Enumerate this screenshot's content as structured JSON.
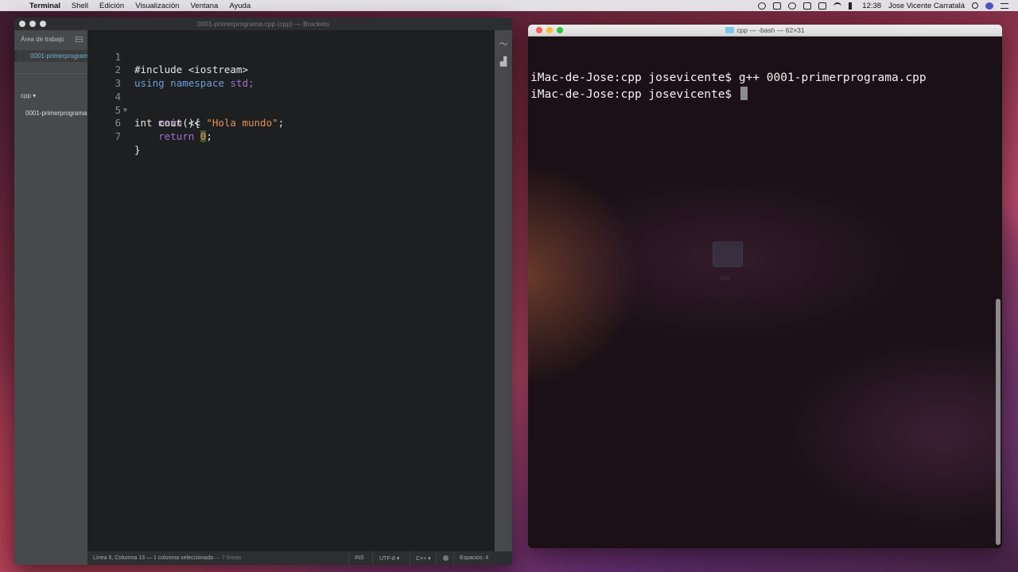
{
  "menubar": {
    "apple_icon": "apple-icon",
    "app_name": "Terminal",
    "items": [
      "Shell",
      "Edición",
      "Visualización",
      "Ventana",
      "Ayuda"
    ],
    "clock": "12:38",
    "user": "Jose Vicente Carratalá"
  },
  "brackets": {
    "title": "0001-primerprograma.cpp (cpp) — Brackets",
    "sidebar": {
      "working_set_label": "Área de trabajo",
      "working_set_file": "0001-primerprograma.cpp",
      "project_name": "cpp ▾",
      "tree_file": "0001-primerprograma.cpp"
    },
    "code": {
      "line_numbers": [
        "1",
        "2",
        "3",
        "4",
        "5",
        "6",
        "7"
      ],
      "l1": "#include <iostream>",
      "l2_kw1": "using",
      "l2_kw2": "namespace",
      "l2_rest": "std;",
      "l4_type": "int",
      "l4_fn": "main",
      "l4_rest": "(){",
      "l5_a": "    cout << ",
      "l5_str": "\"Hola mundo\"",
      "l5_b": ";",
      "l6_kw": "    return",
      "l6_sp": " ",
      "l6_num": "0",
      "l6_b": ";",
      "l7": "}"
    },
    "status": {
      "position": "Línea 6, Columna 13 — 1 columna seleccionada",
      "lines": " — 7 líneas",
      "mode": "INS",
      "encoding": "UTF-8 ▾",
      "language": "C++ ▾",
      "spaces": "Espacios:  4"
    }
  },
  "terminal": {
    "title": "cpp — -bash — 62×31",
    "lines": [
      "iMac-de-Jose:cpp josevicente$ g++ 0001-primerprograma.cpp",
      "iMac-de-Jose:cpp josevicente$ "
    ],
    "desktop_folder_label": "cpp"
  }
}
